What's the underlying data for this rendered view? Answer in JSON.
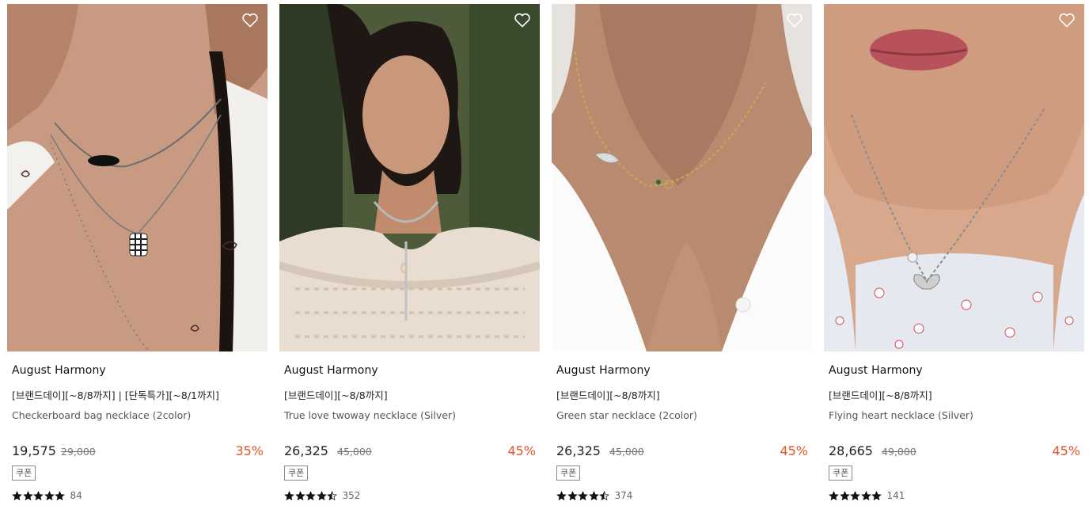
{
  "products": [
    {
      "brand": "August Harmony",
      "promo": "[브랜드데이][~8/8까지] | [단독특가][~8/1까지]",
      "name": "Checkerboard bag necklace (2color)",
      "price": "19,575",
      "original_price": "29,000",
      "discount": "35%",
      "coupon": "쿠폰",
      "rating": 5,
      "review_count": "84"
    },
    {
      "brand": "August Harmony",
      "promo": "[브랜드데이][~8/8까지]",
      "name": "True love twoway necklace (Silver)",
      "price": "26,325",
      "original_price": "45,000",
      "discount": "45%",
      "coupon": "쿠폰",
      "rating": 4.5,
      "review_count": "352"
    },
    {
      "brand": "August Harmony",
      "promo": "[브랜드데이][~8/8까지]",
      "name": "Green star necklace (2color)",
      "price": "26,325",
      "original_price": "45,000",
      "discount": "45%",
      "coupon": "쿠폰",
      "rating": 4.5,
      "review_count": "374"
    },
    {
      "brand": "August Harmony",
      "promo": "[브랜드데이][~8/8까지]",
      "name": "Flying heart necklace (Silver)",
      "price": "28,665",
      "original_price": "49,000",
      "discount": "45%",
      "coupon": "쿠폰",
      "rating": 5,
      "review_count": "141"
    }
  ],
  "icons": {
    "wishlist": "heart-outline-icon",
    "rating": "star-icon"
  },
  "colors": {
    "discount": "#e3522a",
    "star": "#111111",
    "brand_text": "#111111"
  }
}
